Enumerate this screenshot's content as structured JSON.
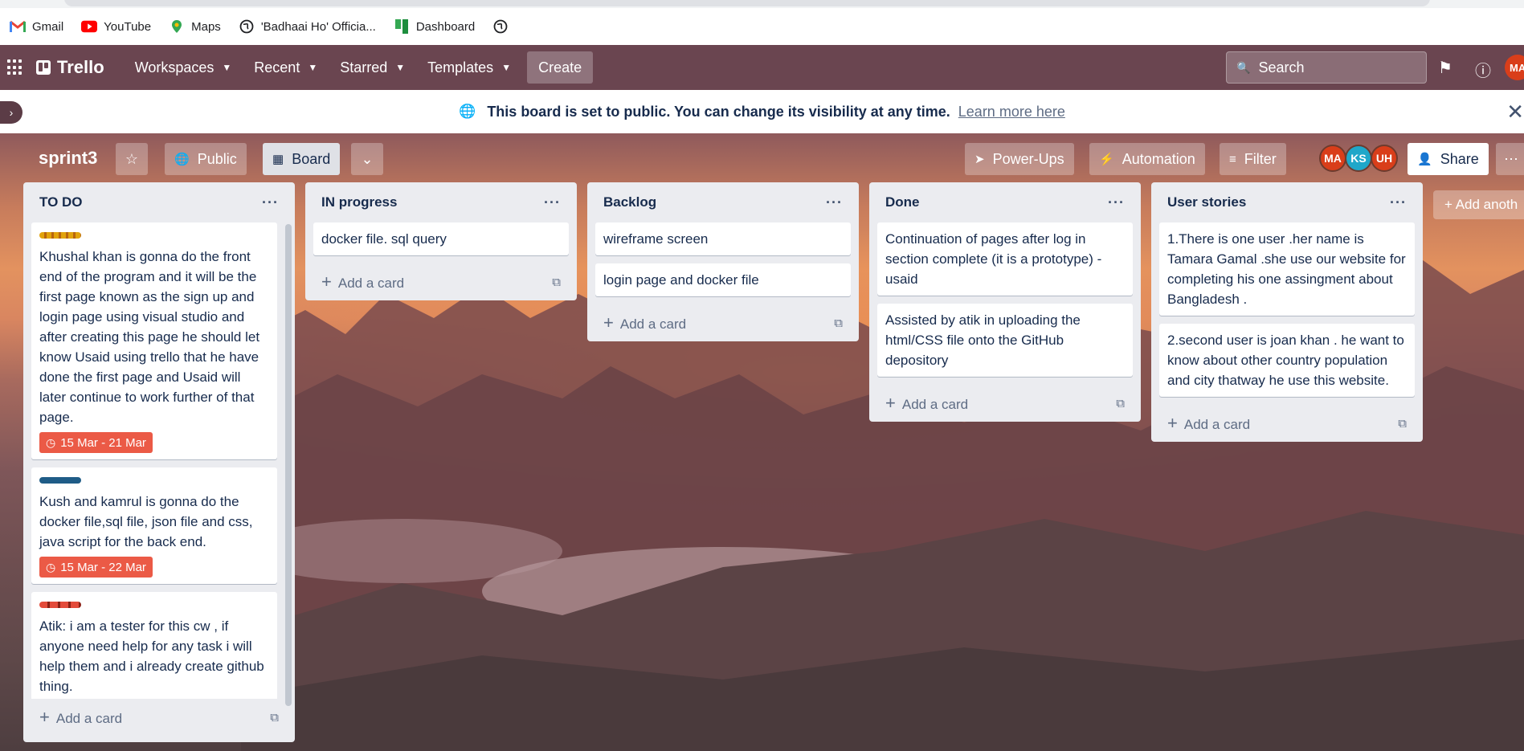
{
  "bookmarks": [
    {
      "label": "Gmail",
      "icon": "gmail-icon"
    },
    {
      "label": "YouTube",
      "icon": "youtube-icon"
    },
    {
      "label": "Maps",
      "icon": "maps-icon"
    },
    {
      "label": "'Badhaai Ho' Officia...",
      "icon": "globe-icon"
    },
    {
      "label": "Dashboard",
      "icon": "trello-icon"
    }
  ],
  "header": {
    "logo": "Trello",
    "nav": [
      "Workspaces",
      "Recent",
      "Starred",
      "Templates"
    ],
    "create": "Create",
    "search_placeholder": "Search",
    "avatar": "MA"
  },
  "banner": {
    "message": "This board is set to public. You can change its visibility at any time.",
    "link": "Learn more here"
  },
  "board": {
    "name": "sprint3",
    "visibility": "Public",
    "view": "Board",
    "powerups": "Power-Ups",
    "automation": "Automation",
    "filter": "Filter",
    "share": "Share",
    "members": [
      {
        "initials": "MA",
        "color": "#d93e1a"
      },
      {
        "initials": "KS",
        "color": "#1fa7c9"
      },
      {
        "initials": "UH",
        "color": "#d93e1a"
      }
    ],
    "add_list": "+ Add anoth"
  },
  "lists": [
    {
      "title": "TO DO",
      "cards": [
        {
          "label_color": "#e2a30b",
          "text": "Khushal khan is gonna do the front end of the program and it will be the first page known as the sign up and login page using visual studio and after creating this page he should let know Usaid using trello that he have done the first page and Usaid will later continue to work further of that page.",
          "due": "15 Mar - 21 Mar"
        },
        {
          "label_color": "#1f5c87",
          "text": "Kush and kamrul is gonna do the docker file,sql file, json file and css, java script for the back end.",
          "due": "15 Mar - 22 Mar"
        },
        {
          "label_color": "#e34b3a",
          "text": "Atik: i am a tester for this cw , if anyone need help for any task i will help them and i already create github thing.",
          "due": ""
        }
      ],
      "add_card": "Add a card"
    },
    {
      "title": "IN progress",
      "cards": [
        {
          "text": "docker file. sql query"
        }
      ],
      "add_card": "Add a card"
    },
    {
      "title": "Backlog",
      "cards": [
        {
          "text": "wireframe screen"
        },
        {
          "text": "login page and docker file"
        }
      ],
      "add_card": "Add a card"
    },
    {
      "title": "Done",
      "cards": [
        {
          "text": "Continuation of pages after log in section complete (it is a prototype) - usaid"
        },
        {
          "text": "Assisted by atik in uploading the html/CSS file onto the GitHub depository"
        }
      ],
      "add_card": "Add a card"
    },
    {
      "title": "User stories",
      "cards": [
        {
          "text": "1.There is one user .her name is Tamara Gamal .she use our website for completing his one assingment about Bangladesh ."
        },
        {
          "text": "2.second user is joan khan . he want to know about other country population and city thatway he use this website."
        }
      ],
      "add_card": "Add a card"
    }
  ]
}
